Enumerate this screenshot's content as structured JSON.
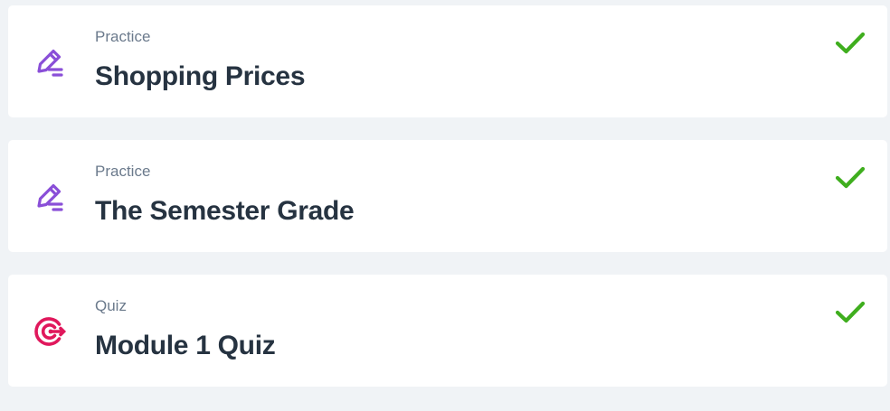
{
  "colors": {
    "background": "#f0f3f6",
    "card": "#ffffff",
    "practice_icon": "#8a4fd8",
    "quiz_icon": "#e0185c",
    "check": "#3fae1e",
    "label": "#6b7a8c",
    "title": "#263341"
  },
  "items": [
    {
      "type_label": "Practice",
      "title": "Shopping Prices",
      "icon": "pencil-icon",
      "status_icon": "checkmark-icon"
    },
    {
      "type_label": "Practice",
      "title": "The Semester Grade",
      "icon": "pencil-icon",
      "status_icon": "checkmark-icon"
    },
    {
      "type_label": "Quiz",
      "title": "Module 1 Quiz",
      "icon": "target-icon",
      "status_icon": "checkmark-icon"
    }
  ]
}
